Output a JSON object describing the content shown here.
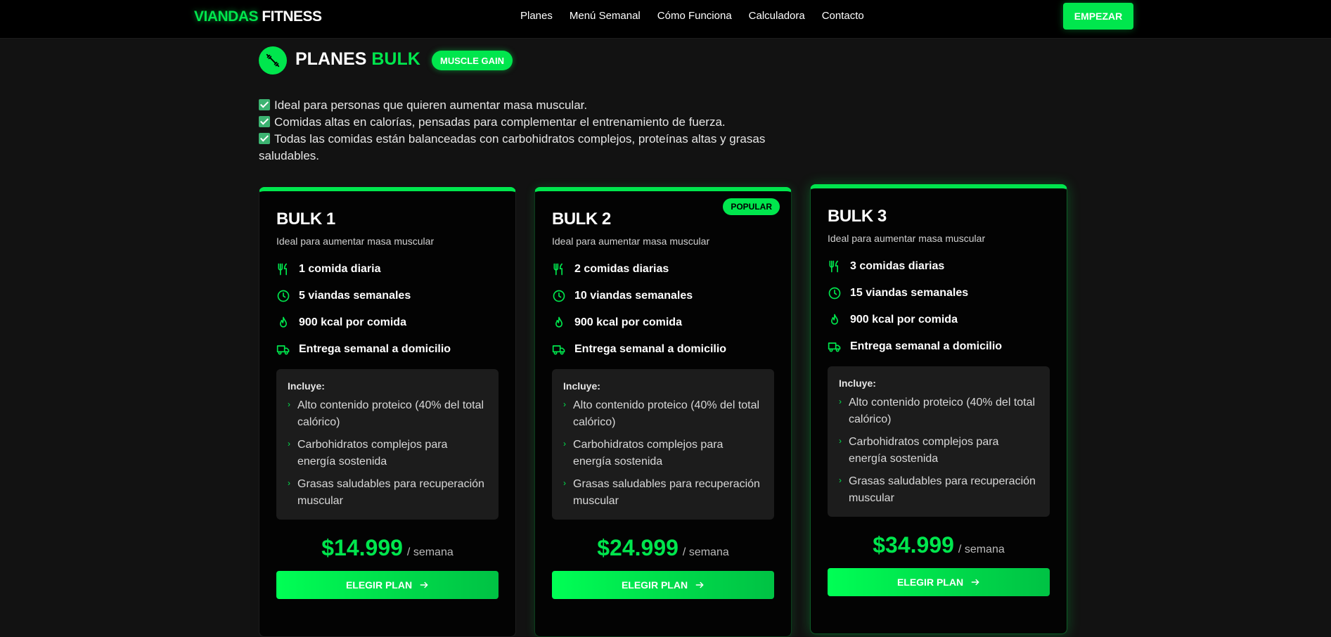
{
  "nav": {
    "logo_green": "VIANDAS",
    "logo_white": "FITNESS",
    "links": [
      "Planes",
      "Menú Semanal",
      "Cómo Funciona",
      "Calculadora",
      "Contacto"
    ],
    "cta": "EMPEZAR"
  },
  "section": {
    "icon": "dumbbell-icon",
    "title_white": "PLANES",
    "title_green": "BULK",
    "badge": "MUSCLE GAIN",
    "bullets": [
      "Ideal para personas que quieren aumentar masa muscular.",
      "Comidas altas en calorías, pensadas para complementar el entrenamiento de fuerza.",
      "Todas las comidas están balanceadas con carbohidratos complejos, proteínas altas y grasas saludables."
    ]
  },
  "colors": {
    "accent": "#00e64d",
    "background": "#121212",
    "card": "#030303",
    "panel": "#1c1c1c"
  },
  "plans": [
    {
      "name": "BULK 1",
      "desc": "Ideal para aumentar masa muscular",
      "features": [
        "1 comida diaria",
        "5 viandas semanales",
        "900 kcal por comida",
        "Entrega semanal a domicilio"
      ],
      "includes_title": "Incluye:",
      "includes": [
        "Alto contenido proteico (40% del total calórico)",
        "Carbohidratos complejos para energía sostenida",
        "Grasas saludables para recuperación muscular"
      ],
      "price": "$14.999",
      "per": "/ semana",
      "button": "ELEGIR PLAN"
    },
    {
      "name": "BULK 2",
      "badge": "POPULAR",
      "desc": "Ideal para aumentar masa muscular",
      "features": [
        "2 comidas diarias",
        "10 viandas semanales",
        "900 kcal por comida",
        "Entrega semanal a domicilio"
      ],
      "includes_title": "Incluye:",
      "includes": [
        "Alto contenido proteico (40% del total calórico)",
        "Carbohidratos complejos para energía sostenida",
        "Grasas saludables para recuperación muscular"
      ],
      "price": "$24.999",
      "per": "/ semana",
      "button": "ELEGIR PLAN"
    },
    {
      "name": "BULK 3",
      "desc": "Ideal para aumentar masa muscular",
      "features": [
        "3 comidas diarias",
        "15 viandas semanales",
        "900 kcal por comida",
        "Entrega semanal a domicilio"
      ],
      "includes_title": "Incluye:",
      "includes": [
        "Alto contenido proteico (40% del total calórico)",
        "Carbohidratos complejos para energía sostenida",
        "Grasas saludables para recuperación muscular"
      ],
      "price": "$34.999",
      "per": "/ semana",
      "button": "ELEGIR PLAN"
    }
  ]
}
